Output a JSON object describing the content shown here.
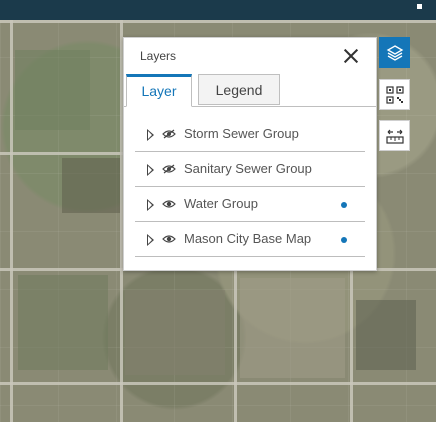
{
  "layers_panel": {
    "title": "Layers",
    "tabs": [
      {
        "label": "Layer",
        "active": true
      },
      {
        "label": "Legend",
        "active": false
      }
    ],
    "layers": [
      {
        "name": "Storm Sewer Group",
        "visibility": "hidden",
        "has_indicator": false
      },
      {
        "name": "Sanitary Sewer Group",
        "visibility": "hidden",
        "has_indicator": false
      },
      {
        "name": "Water Group",
        "visibility": "visible",
        "has_indicator": true
      },
      {
        "name": "Mason City Base Map",
        "visibility": "visible",
        "has_indicator": true
      }
    ]
  },
  "toolbar": {
    "buttons": [
      {
        "name": "layers-icon",
        "active": true
      },
      {
        "name": "qr-grid-icon",
        "active": false
      },
      {
        "name": "measure-icon",
        "active": false
      }
    ]
  },
  "colors": {
    "accent": "#1476b8",
    "top_bar": "#1b3a4b"
  }
}
